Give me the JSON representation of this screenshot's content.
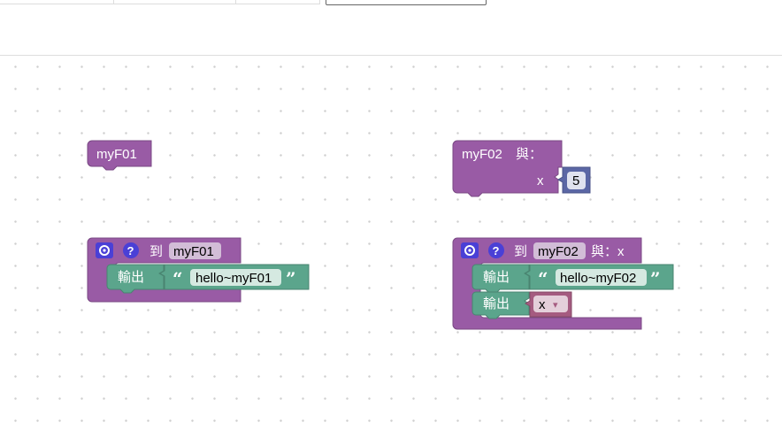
{
  "colors": {
    "procedure": "#995ba5",
    "procedure_dark": "#7a4984",
    "text_block": "#5ba58c",
    "text_dark": "#498470",
    "math_block": "#5b67a5",
    "variable_block": "#a55b80",
    "field_bg": "#d2bdd7"
  },
  "blocks": {
    "call_f01": {
      "name": "myF01"
    },
    "call_f02": {
      "name": "myF02",
      "with_label": "與：",
      "arg_label": "x",
      "arg_value": "5"
    },
    "def_f01": {
      "to_label": "到",
      "name": "myF01",
      "return_label": "輸出",
      "string_value": "hello~myF01"
    },
    "def_f02": {
      "to_label": "到",
      "name": "myF02",
      "params_label": "與：x",
      "return_label_1": "輸出",
      "string_value": "hello~myF02",
      "return_label_2": "輸出",
      "var_name": "x"
    }
  },
  "quote_open": "“",
  "quote_close": "”",
  "icons": {
    "gear": "gear-icon",
    "help": "help-icon",
    "dropdown": "dropdown-arrow-icon"
  },
  "help_glyph": "?",
  "dropdown_glyph": "▾"
}
